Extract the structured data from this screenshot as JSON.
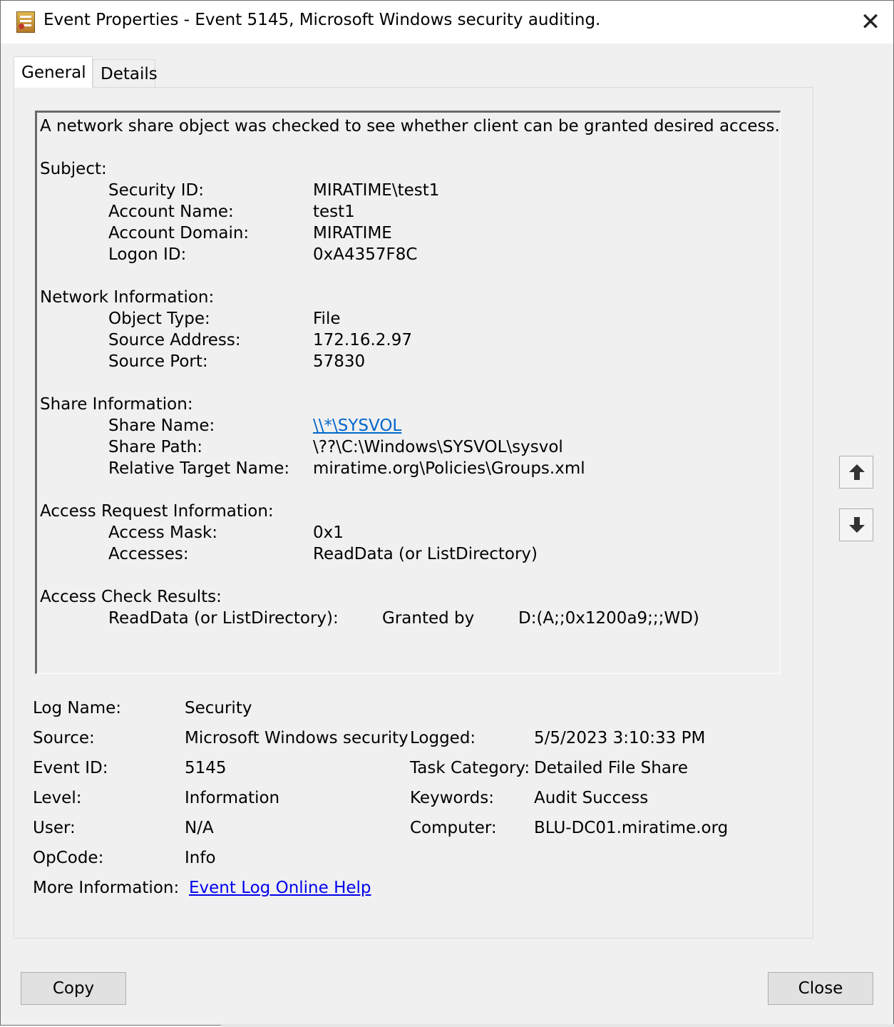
{
  "window": {
    "title": "Event Properties - Event 5145, Microsoft Windows security auditing.",
    "close_glyph": "✕"
  },
  "tabs": [
    {
      "label": "General"
    },
    {
      "label": "Details"
    }
  ],
  "description": {
    "summary": "A network share object was checked to see whether client can be granted desired access.",
    "subject": {
      "heading": "Subject:",
      "rows": [
        {
          "label": "Security ID:",
          "value": "MIRATIME\\test1"
        },
        {
          "label": "Account Name:",
          "value": "test1"
        },
        {
          "label": "Account Domain:",
          "value": "MIRATIME"
        },
        {
          "label": "Logon ID:",
          "value": "0xA4357F8C"
        }
      ]
    },
    "network": {
      "heading": "Network Information:",
      "rows": [
        {
          "label": "Object Type:",
          "value": "File"
        },
        {
          "label": "Source Address:",
          "value": "172.16.2.97"
        },
        {
          "label": "Source Port:",
          "value": "57830"
        }
      ]
    },
    "share": {
      "heading": "Share Information:",
      "rows": [
        {
          "label": "Share Name:",
          "value": "\\\\*\\SYSVOL"
        },
        {
          "label": "Share Path:",
          "value": "\\??\\C:\\Windows\\SYSVOL\\sysvol"
        },
        {
          "label": "Relative Target Name:",
          "value": "miratime.org\\Policies\\Groups.xml"
        }
      ]
    },
    "access_request": {
      "heading": "Access Request Information:",
      "rows": [
        {
          "label": "Access Mask:",
          "value": "0x1"
        },
        {
          "label": "Accesses:",
          "value": "ReadData (or ListDirectory)"
        }
      ]
    },
    "access_check": {
      "heading": "Access Check Results:",
      "right": "ReadData (or ListDirectory):",
      "granted_by": "Granted by",
      "sddl": "D:(A;;0x1200a9;;;WD)"
    }
  },
  "properties": {
    "log_name": {
      "label": "Log Name:",
      "value": "Security"
    },
    "source": {
      "label": "Source:",
      "value": "Microsoft Windows security"
    },
    "logged": {
      "label": "Logged:",
      "value": "5/5/2023 3:10:33 PM"
    },
    "event_id": {
      "label": "Event ID:",
      "value": "5145"
    },
    "task_category": {
      "label": "Task Category:",
      "value": "Detailed File Share"
    },
    "level": {
      "label": "Level:",
      "value": "Information"
    },
    "keywords": {
      "label": "Keywords:",
      "value": "Audit Success"
    },
    "user": {
      "label": "User:",
      "value": "N/A"
    },
    "computer": {
      "label": "Computer:",
      "value": "BLU-DC01.miratime.org"
    },
    "opcode": {
      "label": "OpCode:",
      "value": "Info"
    },
    "more_info": {
      "label": "More Information:",
      "link": "Event Log Online Help"
    }
  },
  "buttons": {
    "copy": "Copy",
    "close": "Close"
  },
  "icons": {
    "app": "event-log-icon",
    "up": "arrow-up-icon",
    "down": "arrow-down-icon"
  }
}
